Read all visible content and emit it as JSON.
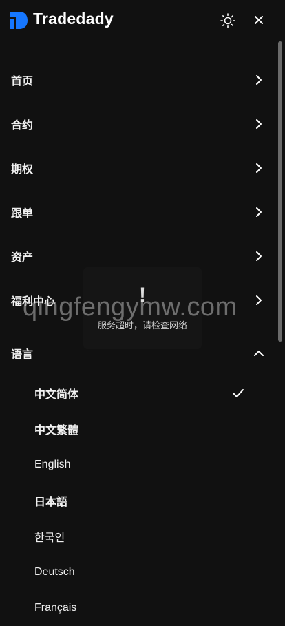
{
  "header": {
    "brand": "Tradedady",
    "logo_color": "#1677ff"
  },
  "menu": [
    {
      "label": "首页"
    },
    {
      "label": "合约"
    },
    {
      "label": "期权"
    },
    {
      "label": "跟单"
    },
    {
      "label": "资产"
    },
    {
      "label": "福利中心"
    }
  ],
  "language": {
    "label": "语言",
    "expanded": true,
    "options": [
      {
        "label": "中文简体",
        "selected": true
      },
      {
        "label": "中文繁體"
      },
      {
        "label": "English"
      },
      {
        "label": "日本語"
      },
      {
        "label": "한국인"
      },
      {
        "label": "Deutsch"
      },
      {
        "label": "Français"
      }
    ]
  },
  "toast": {
    "icon": "!",
    "message": "服务超时，请检查网络"
  },
  "watermark": "qingfengymw.com",
  "colors": {
    "background": "#111111",
    "text": "#ffffff",
    "accent": "#1677ff"
  }
}
